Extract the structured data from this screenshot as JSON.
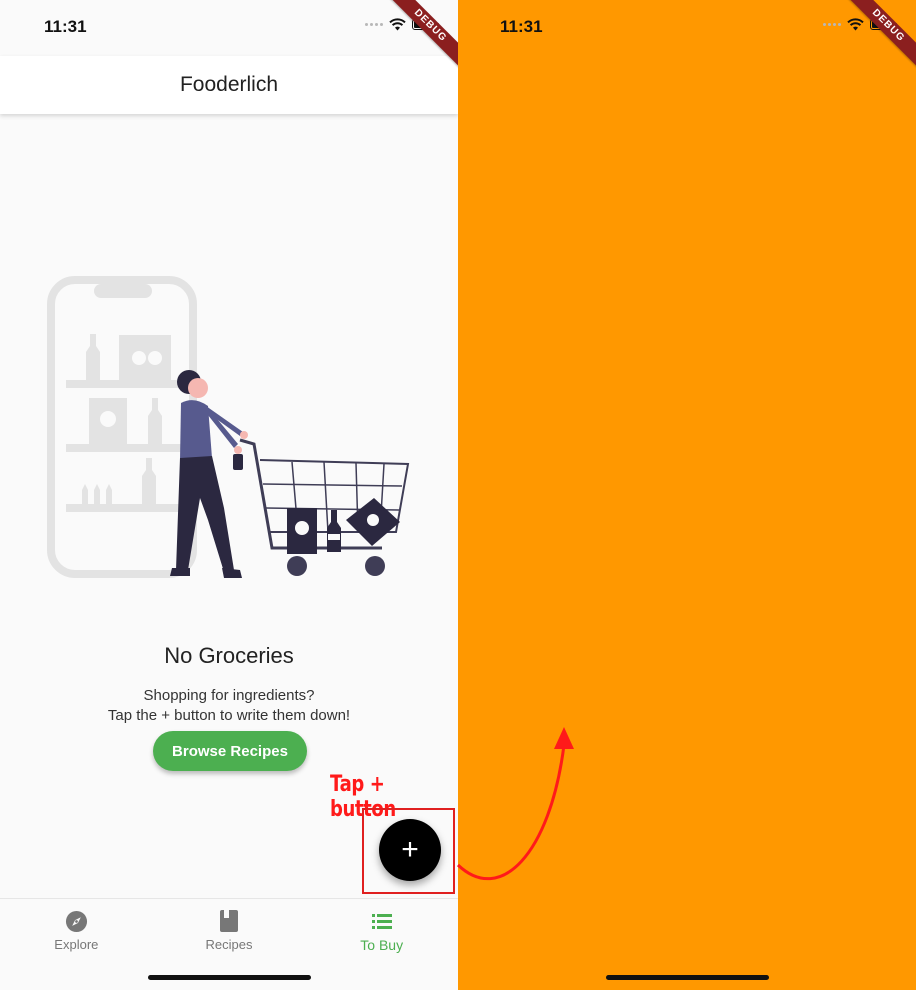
{
  "left_screen": {
    "status_bar": {
      "time": "11:31",
      "debug_label": "DEBUG"
    },
    "app_bar": {
      "title": "Fooderlich"
    },
    "empty_state": {
      "title": "No Groceries",
      "message_line1": "Shopping for ingredients?",
      "message_line2": "Tap the + button to write them down!",
      "browse_button": "Browse Recipes"
    },
    "fab_label": "+",
    "annotation": "Tap + button",
    "bottom_nav": [
      {
        "label": "Explore",
        "icon": "compass-icon",
        "active": false
      },
      {
        "label": "Recipes",
        "icon": "book-icon",
        "active": false
      },
      {
        "label": "To Buy",
        "icon": "list-icon",
        "active": true
      }
    ]
  },
  "right_screen": {
    "status_bar": {
      "time": "11:31",
      "debug_label": "DEBUG"
    },
    "background_color": "#ff9800"
  },
  "colors": {
    "accent_green": "#4caf50",
    "orange": "#ff9800",
    "annotation_red": "#ff1a1a",
    "fab": "#000000"
  }
}
